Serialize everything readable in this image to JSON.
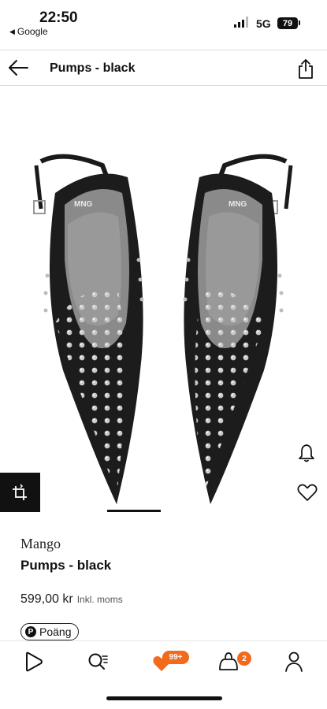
{
  "status_bar": {
    "time": "22:50",
    "back_app": "Google",
    "network": "5G",
    "battery": "79"
  },
  "header": {
    "title": "Pumps - black"
  },
  "product_image": {
    "logo_left": "MNG",
    "logo_right": "MNG"
  },
  "product": {
    "brand": "Mango",
    "name": "Pumps - black",
    "price": "599,00 kr",
    "vat_note": "Inkl. moms",
    "points_label": "Poäng",
    "points_icon": "P"
  },
  "bottom_nav": {
    "wishlist_badge": "99+",
    "bag_badge": "2"
  },
  "colors": {
    "accent": "#f26a1b",
    "text": "#111111"
  },
  "icons": {
    "back": "arrow-left-icon",
    "share": "share-icon",
    "bell": "bell-icon",
    "heart": "heart-icon",
    "ar": "view-in-room-icon",
    "home": "home-icon",
    "search": "search-icon",
    "wishlist": "heart-icon",
    "bag": "bag-icon",
    "profile": "profile-icon"
  }
}
